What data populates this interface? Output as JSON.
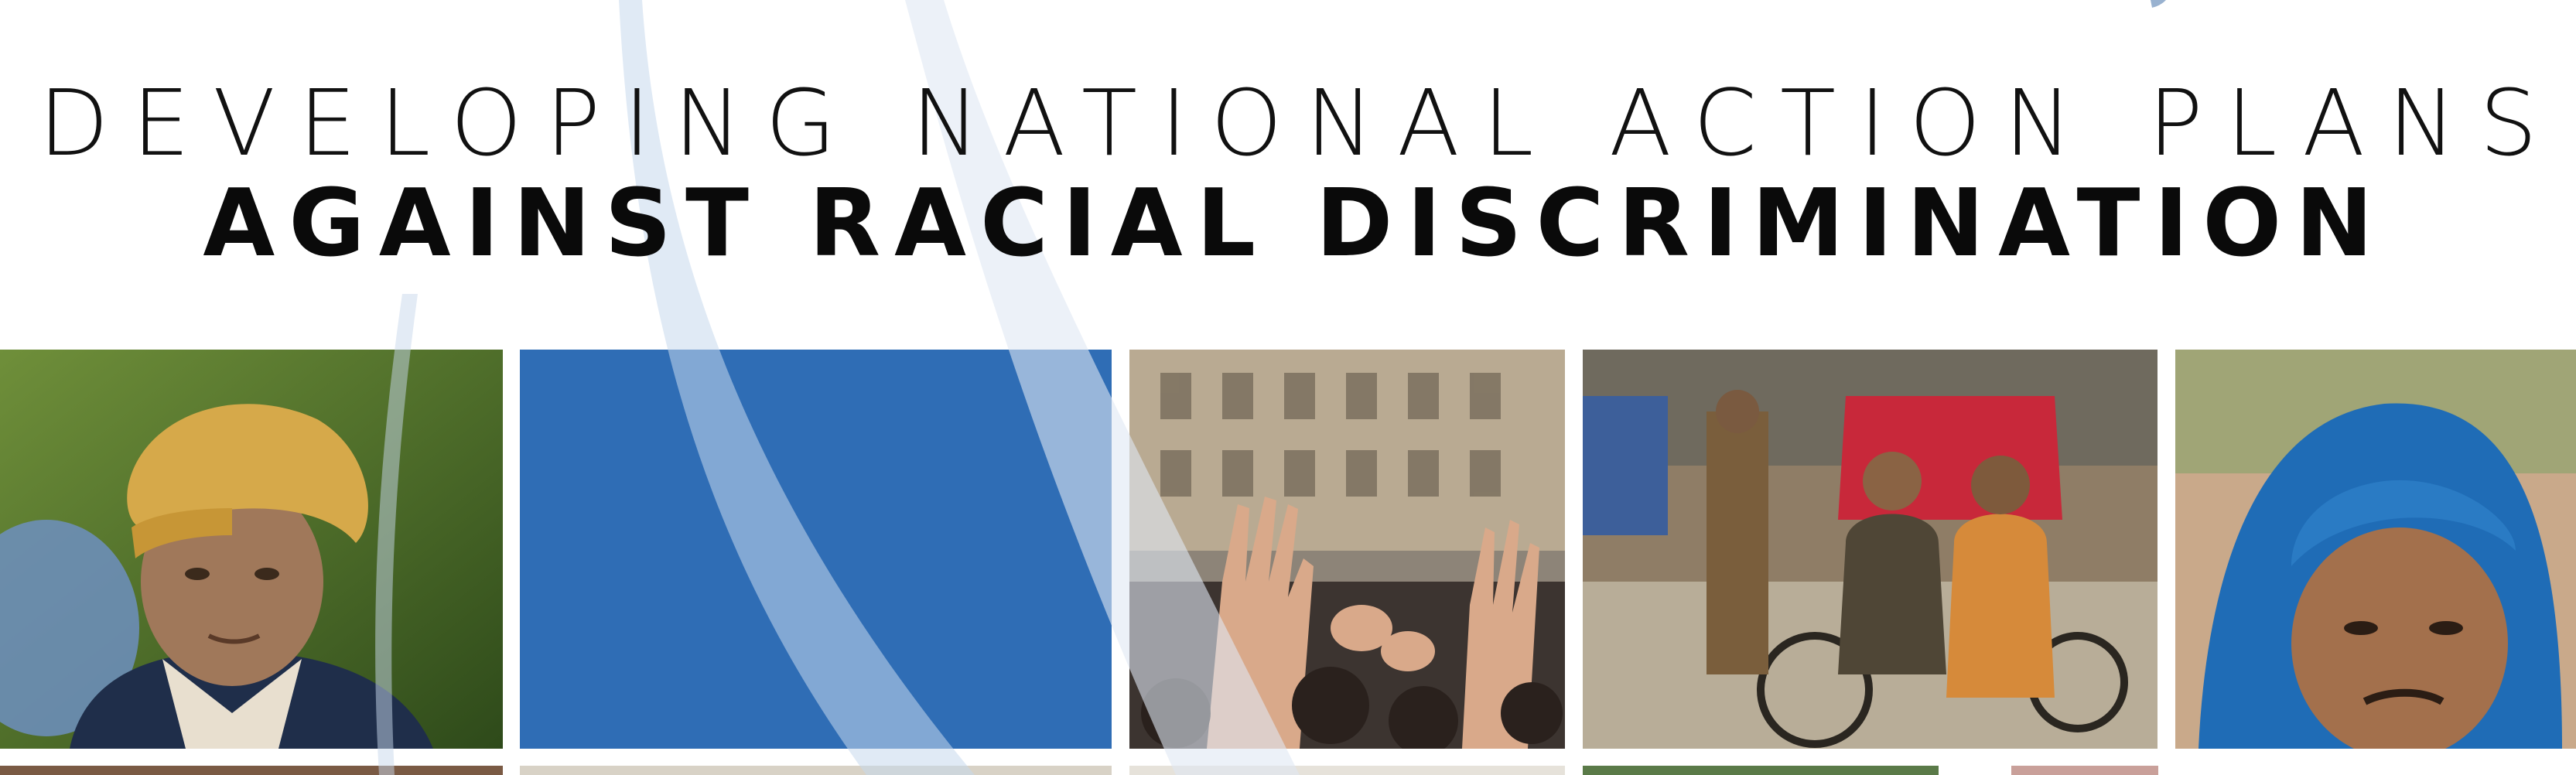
{
  "cover": {
    "title_line1": "DEVELOPING NATIONAL ACTION PLANS",
    "title_line2": "AGAINST RACIAL DISCRIMINATION"
  },
  "photos": [
    {
      "id": "portrait-elderly-man-yellow-headwrap"
    },
    {
      "id": "solid-blue-panel"
    },
    {
      "id": "raised-hands-crowd-street"
    },
    {
      "id": "two-men-on-rickshaw"
    },
    {
      "id": "portrait-man-blue-turban"
    }
  ],
  "colors": {
    "accent_blue": "#2f6db5",
    "sail_light": "#dfe8f3",
    "sail_mid": "#c7d8ec",
    "title_text": "#111111",
    "background": "#ffffff"
  }
}
